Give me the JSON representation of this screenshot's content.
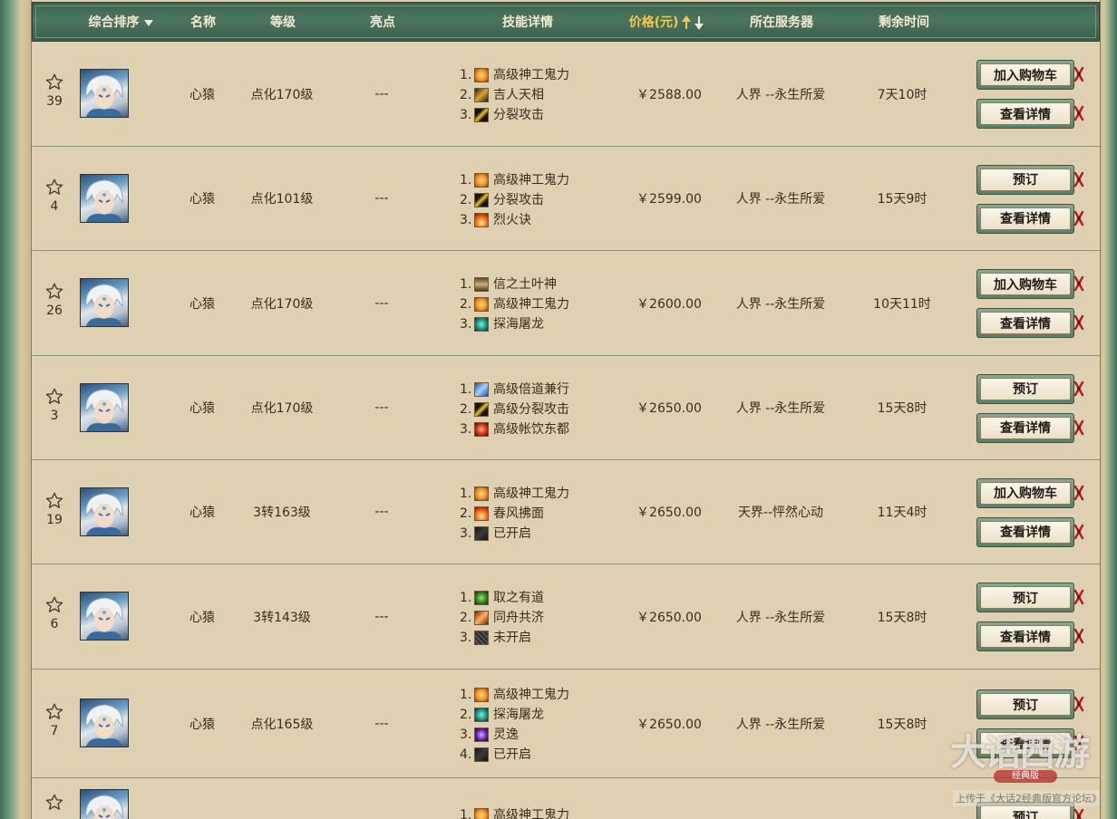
{
  "header": {
    "sort_label": "综合排序",
    "name_label": "名称",
    "level_label": "等级",
    "highlight_label": "亮点",
    "skills_label": "技能详情",
    "price_label": "价格(元)",
    "server_label": "所在服务器",
    "time_label": "剩余时间"
  },
  "colors": {
    "header_bg": "#4b7560",
    "panel_bg": "#ded0b0",
    "active_sort": "#f2c94c"
  },
  "rows": [
    {
      "fav": "39",
      "name": "心猿",
      "level": "点化170级",
      "highlight": "---",
      "skills": [
        {
          "n": "1.",
          "label": "高级神工鬼力",
          "icon": "orange-swirl-icon"
        },
        {
          "n": "2.",
          "label": "吉人天相",
          "icon": "gold-figure-icon"
        },
        {
          "n": "3.",
          "label": "分裂攻击",
          "icon": "yellow-slash-icon"
        }
      ],
      "price": "￥2588.00",
      "server": "人界 --永生所爱",
      "time": "7天10时",
      "btn1": "加入购物车",
      "btn2": "查看详情"
    },
    {
      "fav": "4",
      "name": "心猿",
      "level": "点化101级",
      "highlight": "---",
      "skills": [
        {
          "n": "1.",
          "label": "高级神工鬼力",
          "icon": "orange-swirl-icon"
        },
        {
          "n": "2.",
          "label": "分裂攻击",
          "icon": "yellow-slash-icon"
        },
        {
          "n": "3.",
          "label": "烈火诀",
          "icon": "fire-icon"
        }
      ],
      "price": "￥2599.00",
      "server": "人界 --永生所爱",
      "time": "15天9时",
      "btn1": "预订",
      "btn2": "查看详情"
    },
    {
      "fav": "26",
      "name": "心猿",
      "level": "点化170级",
      "highlight": "---",
      "skills": [
        {
          "n": "1.",
          "label": "信之土叶神",
          "icon": "earth-figure-icon"
        },
        {
          "n": "2.",
          "label": "高级神工鬼力",
          "icon": "orange-swirl-icon"
        },
        {
          "n": "3.",
          "label": "探海屠龙",
          "icon": "teal-dragon-icon"
        }
      ],
      "price": "￥2600.00",
      "server": "人界 --永生所爱",
      "time": "10天11时",
      "btn1": "加入购物车",
      "btn2": "查看详情"
    },
    {
      "fav": "3",
      "name": "心猿",
      "level": "点化170级",
      "highlight": "---",
      "skills": [
        {
          "n": "1.",
          "label": "高级倍道兼行",
          "icon": "blue-wind-icon"
        },
        {
          "n": "2.",
          "label": "高级分裂攻击",
          "icon": "yellow-slash-icon"
        },
        {
          "n": "3.",
          "label": "高级帐饮东都",
          "icon": "red-orb-icon"
        }
      ],
      "price": "￥2650.00",
      "server": "人界 --永生所爱",
      "time": "15天8时",
      "btn1": "预订",
      "btn2": "查看详情"
    },
    {
      "fav": "19",
      "name": "心猿",
      "level": "3转163级",
      "highlight": "---",
      "skills": [
        {
          "n": "1.",
          "label": "高级神工鬼力",
          "icon": "orange-swirl-icon"
        },
        {
          "n": "2.",
          "label": "春风拂面",
          "icon": "fire-icon"
        },
        {
          "n": "3.",
          "label": "已开启",
          "icon": "dark-slot-icon"
        }
      ],
      "price": "￥2650.00",
      "server": "天界--怦然心动",
      "time": "11天4时",
      "btn1": "加入购物车",
      "btn2": "查看详情"
    },
    {
      "fav": "6",
      "name": "心猿",
      "level": "3转143级",
      "highlight": "---",
      "skills": [
        {
          "n": "1.",
          "label": "取之有道",
          "icon": "green-figure-icon"
        },
        {
          "n": "2.",
          "label": "同舟共济",
          "icon": "orange-flame-icon"
        },
        {
          "n": "3.",
          "label": "未开启",
          "icon": "locked-slot-icon"
        }
      ],
      "price": "￥2650.00",
      "server": "人界 --永生所爱",
      "time": "15天8时",
      "btn1": "预订",
      "btn2": "查看详情"
    },
    {
      "fav": "7",
      "name": "心猿",
      "level": "点化165级",
      "highlight": "---",
      "skills": [
        {
          "n": "1.",
          "label": "高级神工鬼力",
          "icon": "orange-swirl-icon"
        },
        {
          "n": "2.",
          "label": "探海屠龙",
          "icon": "teal-dragon-icon"
        },
        {
          "n": "3.",
          "label": "灵逸",
          "icon": "purple-swirl-icon"
        },
        {
          "n": "4.",
          "label": "已开启",
          "icon": "dark-slot-icon"
        }
      ],
      "price": "￥2650.00",
      "server": "人界 --永生所爱",
      "time": "15天8时",
      "btn1": "预订",
      "btn2": "查看详情"
    },
    {
      "fav": "",
      "name": "",
      "level": "",
      "highlight": "",
      "skills": [
        {
          "n": "1.",
          "label": "高级神工鬼力",
          "icon": "orange-swirl-icon"
        }
      ],
      "price": "",
      "server": "",
      "time": "",
      "btn1": "预订",
      "btn2": ""
    }
  ],
  "watermark": {
    "title": "大话西游",
    "seal": "经典版",
    "caption": "上传于《大话2经典版官方论坛》"
  }
}
